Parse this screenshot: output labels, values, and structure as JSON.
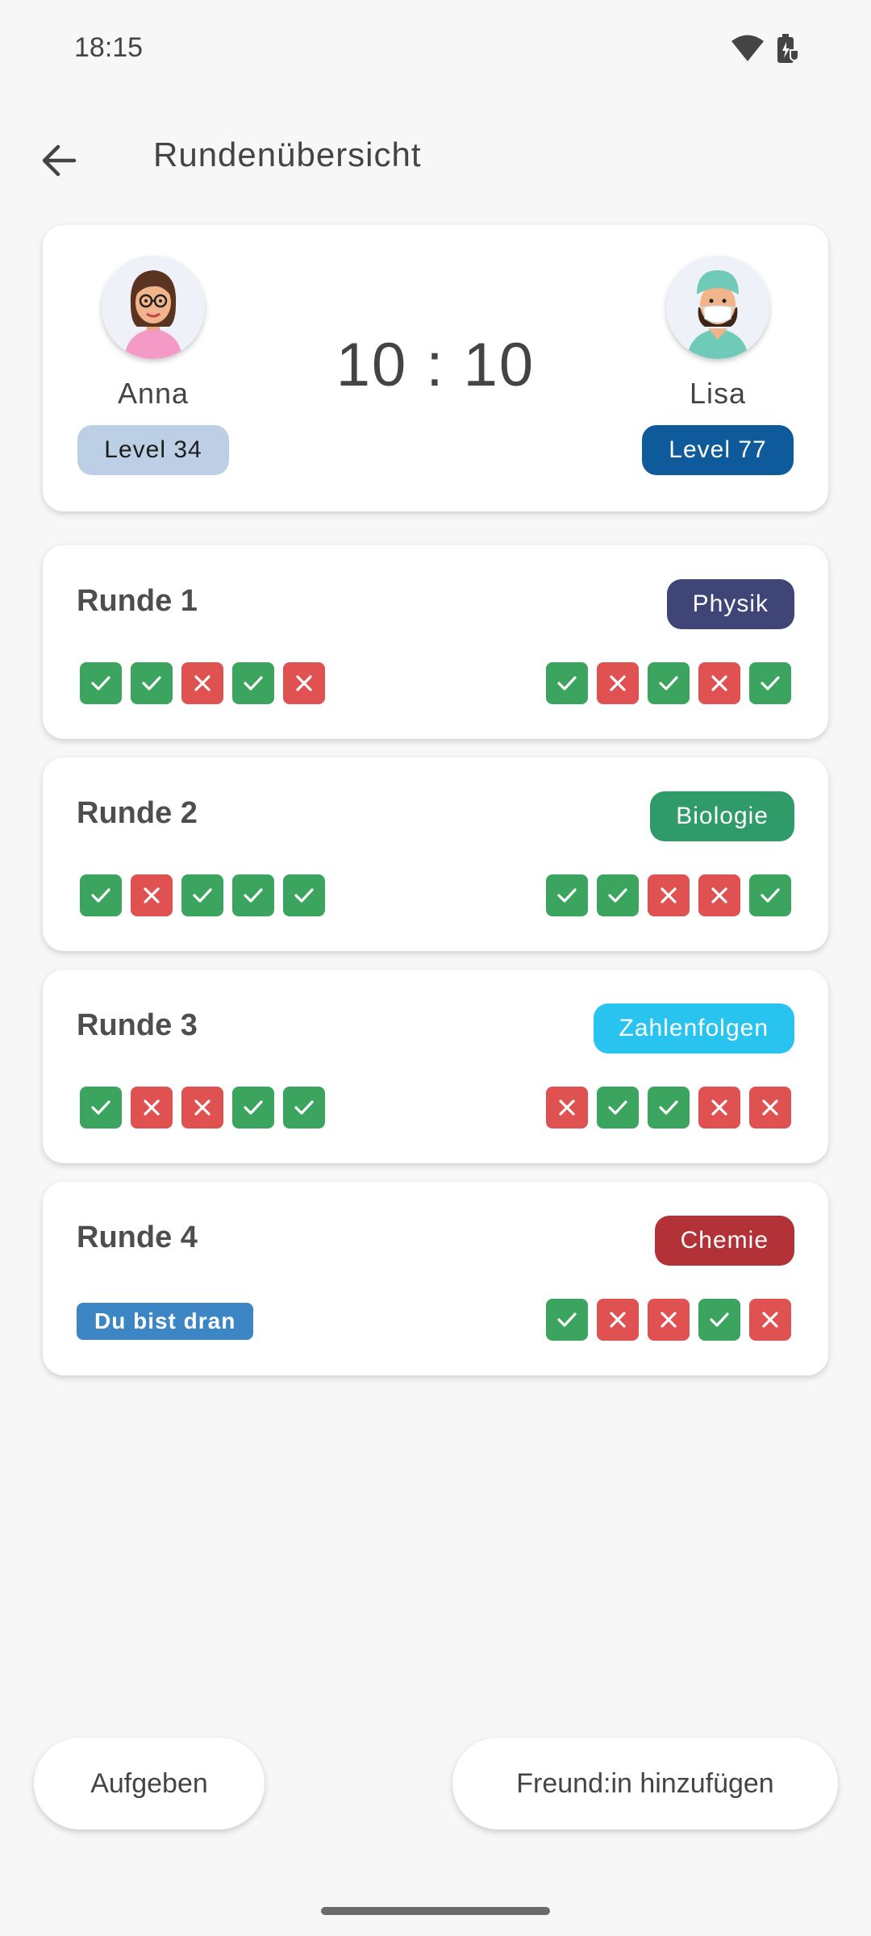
{
  "status_bar": {
    "time": "18:15",
    "icons": [
      "wifi-icon",
      "battery-charging-icon"
    ]
  },
  "app_bar": {
    "back_icon": "arrow-left-icon",
    "title": "Rundenübersicht"
  },
  "match": {
    "player1": {
      "name": "Anna",
      "level": "Level 34",
      "avatar": "woman-with-glasses-avatar"
    },
    "player2": {
      "name": "Lisa",
      "level": "Level 77",
      "avatar": "nurse-with-mask-avatar"
    },
    "score": "10 : 10"
  },
  "rounds": [
    {
      "title": "Runde 1",
      "category": "Physik",
      "category_color": "#3f4677",
      "p1": [
        "ok",
        "ok",
        "bad",
        "ok",
        "bad"
      ],
      "p2": [
        "ok",
        "bad",
        "ok",
        "bad",
        "ok"
      ]
    },
    {
      "title": "Runde 2",
      "category": "Biologie",
      "category_color": "#2f9b68",
      "p1": [
        "ok",
        "bad",
        "ok",
        "ok",
        "ok"
      ],
      "p2": [
        "ok",
        "ok",
        "bad",
        "bad",
        "ok"
      ]
    },
    {
      "title": "Runde 3",
      "category": "Zahlenfolgen",
      "category_color": "#29c3ef",
      "p1": [
        "ok",
        "bad",
        "bad",
        "ok",
        "ok"
      ],
      "p2": [
        "bad",
        "ok",
        "ok",
        "bad",
        "bad"
      ]
    },
    {
      "title": "Runde 4",
      "category": "Chemie",
      "category_color": "#b23237",
      "turn": "Du bist dran",
      "p2": [
        "ok",
        "bad",
        "bad",
        "ok",
        "bad"
      ]
    }
  ],
  "actions": {
    "give_up": "Aufgeben",
    "add_friend": "Freund:in hinzufügen"
  },
  "colors": {
    "correct": "#3ba55f",
    "wrong": "#e05252",
    "background": "#f7f7f7"
  }
}
